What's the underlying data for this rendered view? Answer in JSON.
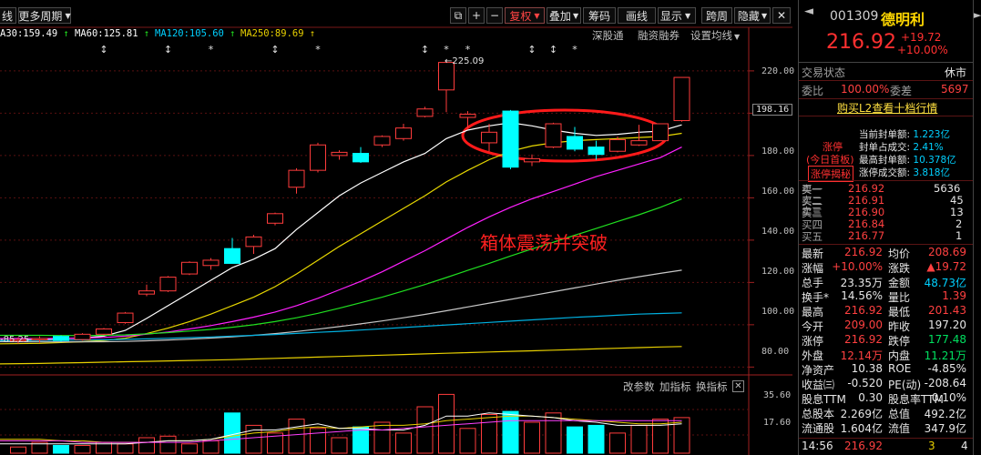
{
  "toolbar": {
    "left_label": "线",
    "period_label": "更多周期",
    "items": [
      "复权",
      "叠加",
      "筹码",
      "画线",
      "显示",
      "跨周",
      "隐藏"
    ]
  },
  "ma_bar": {
    "items": [
      {
        "label": "A30:159.49",
        "arrow": "up",
        "color": "#ffffff"
      },
      {
        "label": "MA60:125.81",
        "arrow": "up",
        "color": "#ffffff"
      },
      {
        "label": "MA120:105.60",
        "arrow": "up",
        "color": "#00d0ff"
      },
      {
        "label": "MA250:89.69",
        "arrow": "up",
        "color": "#e8d000"
      }
    ],
    "menu": [
      "深股通",
      "融资融券",
      "设置均线"
    ]
  },
  "price_axis": {
    "labels": [
      "220.00",
      "200.00",
      "180.00",
      "160.00",
      "140.00",
      "120.00",
      "100.00",
      "80.00"
    ],
    "current": "198.16",
    "low_label": "85.25",
    "high_label": "225.09"
  },
  "annotation": {
    "text": "箱体震荡并突破",
    "color": "#ff2020"
  },
  "indicator": {
    "menu": [
      "改参数",
      "加指标",
      "换指标"
    ],
    "axis": [
      "35.60",
      "17.60"
    ]
  },
  "chart_data": {
    "type": "candlestick",
    "ylim": [
      78,
      232
    ],
    "candles": [
      {
        "o": 92.5,
        "h": 94.0,
        "l": 91.0,
        "c": 93.0
      },
      {
        "o": 93.0,
        "h": 94.5,
        "l": 91.5,
        "c": 93.5
      },
      {
        "o": 94.5,
        "h": 95.0,
        "l": 92.0,
        "c": 92.5
      },
      {
        "o": 93.0,
        "h": 96.0,
        "l": 92.5,
        "c": 95.5
      },
      {
        "o": 95.5,
        "h": 98.5,
        "l": 95.0,
        "c": 98.0
      },
      {
        "o": 101.0,
        "h": 106.0,
        "l": 100.5,
        "c": 105.5
      },
      {
        "o": 114.5,
        "h": 119.0,
        "l": 113.5,
        "c": 116.0
      },
      {
        "o": 116.0,
        "h": 123.0,
        "l": 115.5,
        "c": 122.5
      },
      {
        "o": 124.0,
        "h": 130.0,
        "l": 123.5,
        "c": 129.5
      },
      {
        "o": 128.0,
        "h": 131.5,
        "l": 126.0,
        "c": 130.5
      },
      {
        "o": 136.0,
        "h": 141.0,
        "l": 132.5,
        "c": 129.0
      },
      {
        "o": 137.0,
        "h": 142.5,
        "l": 133.5,
        "c": 141.5
      },
      {
        "o": 148.0,
        "h": 153.0,
        "l": 147.0,
        "c": 152.5
      },
      {
        "o": 165.0,
        "h": 174.0,
        "l": 162.0,
        "c": 173.0
      },
      {
        "o": 173.0,
        "h": 186.0,
        "l": 172.0,
        "c": 185.0
      },
      {
        "o": 180.0,
        "h": 182.5,
        "l": 178.0,
        "c": 181.5
      },
      {
        "o": 181.0,
        "h": 184.0,
        "l": 176.5,
        "c": 177.0
      },
      {
        "o": 185.0,
        "h": 189.5,
        "l": 184.0,
        "c": 189.0
      },
      {
        "o": 188.0,
        "h": 195.0,
        "l": 187.0,
        "c": 193.0
      },
      {
        "o": 198.5,
        "h": 203.0,
        "l": 198.0,
        "c": 202.0
      },
      {
        "o": 211.0,
        "h": 225.09,
        "l": 200.5,
        "c": 224.0
      },
      {
        "o": 198.0,
        "h": 201.0,
        "l": 193.0,
        "c": 199.5
      },
      {
        "o": 186.0,
        "h": 195.0,
        "l": 182.0,
        "c": 191.0
      },
      {
        "o": 201.0,
        "h": 201.5,
        "l": 173.5,
        "c": 174.5
      },
      {
        "o": 177.0,
        "h": 180.5,
        "l": 175.0,
        "c": 178.5
      },
      {
        "o": 184.0,
        "h": 195.5,
        "l": 183.5,
        "c": 195.0
      },
      {
        "o": 189.0,
        "h": 193.5,
        "l": 182.0,
        "c": 183.0
      },
      {
        "o": 184.0,
        "h": 187.0,
        "l": 178.0,
        "c": 180.5
      },
      {
        "o": 182.0,
        "h": 189.0,
        "l": 181.5,
        "c": 187.5
      },
      {
        "o": 185.0,
        "h": 194.5,
        "l": 184.5,
        "c": 187.0
      },
      {
        "o": 187.0,
        "h": 195.0,
        "l": 187.0,
        "c": 195.0
      },
      {
        "o": 196.5,
        "h": 216.92,
        "l": 196.0,
        "c": 216.92
      }
    ],
    "ma_lines": [
      {
        "color": "#ffffff",
        "values": [
          92.5,
          93.0,
          93.3,
          93.8,
          94.6,
          97.3,
          103.0,
          109.0,
          115.0,
          121.0,
          127.0,
          131.0,
          136.0,
          145.0,
          153.0,
          161.0,
          167.0,
          172.0,
          177.0,
          181.0,
          188.0,
          192.0,
          194.0,
          195.5,
          194.0,
          192.0,
          190.5,
          189.5,
          190.0,
          191.0,
          191.5,
          194.5
        ]
      },
      {
        "color": "#e8d800",
        "values": [
          91.0,
          91.2,
          91.6,
          92.0,
          92.6,
          93.6,
          95.8,
          98.4,
          101.5,
          105.0,
          109.0,
          113.0,
          118.0,
          124.0,
          130.5,
          137.0,
          143.0,
          149.0,
          155.0,
          161.0,
          167.5,
          173.0,
          178.0,
          182.0,
          184.5,
          186.0,
          187.0,
          187.5,
          188.0,
          188.5,
          189.0,
          190.5
        ]
      },
      {
        "color": "#ff20ff",
        "values": [
          93.5,
          93.5,
          93.5,
          93.7,
          94.0,
          94.6,
          95.5,
          96.6,
          98.0,
          99.6,
          101.5,
          103.6,
          106.0,
          109.0,
          112.5,
          116.5,
          120.5,
          125.0,
          130.0,
          135.0,
          140.5,
          146.0,
          151.0,
          155.5,
          159.5,
          163.0,
          166.5,
          170.0,
          173.0,
          176.0,
          179.0,
          184.0
        ]
      },
      {
        "color": "#20e020",
        "values": [
          95.0,
          95.0,
          94.9,
          94.9,
          95.0,
          95.2,
          95.7,
          96.3,
          97.0,
          97.8,
          98.8,
          100.0,
          101.5,
          103.3,
          105.4,
          107.8,
          110.4,
          113.0,
          116.0,
          119.0,
          122.3,
          125.7,
          129.0,
          132.5,
          135.8,
          139.0,
          142.3,
          145.5,
          148.8,
          152.0,
          155.5,
          159.49
        ]
      },
      {
        "color": "#c8c8c8",
        "values": [
          92.0,
          91.9,
          91.9,
          91.9,
          92.0,
          92.1,
          92.4,
          92.8,
          93.2,
          93.7,
          94.3,
          95.0,
          95.8,
          96.8,
          97.9,
          99.1,
          100.4,
          101.8,
          103.3,
          104.9,
          106.6,
          108.4,
          110.2,
          112.0,
          113.8,
          115.6,
          117.4,
          119.2,
          121.0,
          122.7,
          124.3,
          125.81
        ]
      },
      {
        "color": "#00b0e0",
        "values": [
          92.5,
          92.6,
          92.7,
          92.8,
          92.9,
          93.1,
          93.3,
          93.6,
          93.9,
          94.2,
          94.6,
          95.0,
          95.4,
          95.9,
          96.4,
          96.9,
          97.5,
          98.1,
          98.7,
          99.3,
          99.9,
          100.5,
          101.1,
          101.7,
          102.3,
          102.9,
          103.5,
          104.0,
          104.5,
          105.0,
          105.3,
          105.6
        ]
      },
      {
        "color": "#e8d000",
        "values": [
          81.5,
          81.7,
          81.9,
          82.1,
          82.3,
          82.5,
          82.7,
          82.9,
          83.1,
          83.3,
          83.5,
          83.8,
          84.1,
          84.4,
          84.7,
          85.0,
          85.3,
          85.6,
          85.9,
          86.2,
          86.5,
          86.8,
          87.1,
          87.4,
          87.7,
          88.0,
          88.3,
          88.6,
          88.9,
          89.2,
          89.5,
          89.69
        ]
      }
    ],
    "volume": {
      "ylim": [
        0,
        40
      ],
      "values": [
        4,
        7,
        5,
        5,
        7,
        6,
        10,
        11,
        6,
        8,
        26,
        18,
        13,
        22,
        16,
        10,
        17,
        20,
        13,
        30,
        38,
        16,
        25,
        27,
        20,
        26,
        17,
        18,
        13,
        18,
        22,
        23
      ],
      "lines": [
        {
          "color": "#e8d000",
          "values": [
            9,
            9,
            8,
            8,
            7,
            7,
            7,
            8,
            8,
            9,
            11,
            13,
            14,
            16,
            17,
            16,
            17,
            18,
            18,
            19,
            21,
            22,
            23,
            24,
            24,
            23,
            22,
            21,
            20,
            19,
            19,
            20
          ]
        },
        {
          "color": "#ffffff",
          "values": [
            6,
            6,
            6,
            6,
            6,
            6,
            7,
            8,
            8,
            9,
            12,
            15,
            15,
            17,
            19,
            16,
            16,
            15,
            15,
            18,
            24,
            24,
            26,
            25,
            24,
            23,
            21,
            20,
            18,
            18,
            18,
            19
          ]
        },
        {
          "color": "#ff40ff",
          "values": [
            8,
            8,
            8,
            7,
            7,
            7,
            7,
            7,
            7,
            8,
            9,
            10,
            11,
            12,
            13,
            14,
            15,
            15,
            16,
            17,
            18,
            19,
            20,
            21,
            21,
            21,
            21,
            21,
            21,
            21,
            21,
            21
          ]
        }
      ]
    }
  },
  "panel": {
    "code": "001309",
    "name": "德明利",
    "price": "216.92",
    "change": "+19.72",
    "change_pct": "+10.00%",
    "trade_status_label": "交易状态",
    "trade_status": "休市",
    "wb_label": "委比",
    "wb_value": "100.00%",
    "wc_label": "委差",
    "wc_value": "5697",
    "l2_link": "购买L2查看十档行情",
    "limit_title": "涨停",
    "limit_sub": "(今日首板)",
    "limit_btn": "涨停揭秘",
    "limit_stats": [
      {
        "label": "当前封单额:",
        "value": "1.223亿"
      },
      {
        "label": "封单占成交:",
        "value": "2.41%"
      },
      {
        "label": "最高封单额:",
        "value": "10.378亿"
      },
      {
        "label": "涨停成交额:",
        "value": "3.818亿"
      }
    ],
    "sells": [
      {
        "label": "卖一",
        "price": "",
        "vol": ""
      },
      {
        "label": "卖二",
        "price": "",
        "vol": ""
      },
      {
        "label": "卖三",
        "price": "",
        "vol": ""
      }
    ],
    "buys": [
      {
        "label": "买一",
        "price": "216.92",
        "vol": "5636"
      },
      {
        "label": "买二",
        "price": "216.91",
        "vol": "45"
      },
      {
        "label": "买三",
        "price": "216.90",
        "vol": "13"
      },
      {
        "label": "买四",
        "price": "216.84",
        "vol": "2"
      },
      {
        "label": "买五",
        "price": "216.77",
        "vol": "1"
      }
    ],
    "stats": [
      {
        "l1": "最新",
        "v1": "216.92",
        "c1": "red",
        "l2": "均价",
        "v2": "208.69",
        "c2": "red"
      },
      {
        "l1": "涨幅",
        "v1": "+10.00%",
        "c1": "red",
        "l2": "涨跌",
        "v2": "▲19.72",
        "c2": "red"
      },
      {
        "l1": "总手",
        "v1": "23.35万",
        "c1": "white",
        "l2": "金额",
        "v2": "48.73亿",
        "c2": "cyan"
      },
      {
        "l1": "换手*",
        "v1": "14.56%",
        "c1": "white",
        "l2": "量比",
        "v2": "1.39",
        "c2": "red"
      },
      {
        "l1": "最高",
        "v1": "216.92",
        "c1": "red",
        "l2": "最低",
        "v2": "201.43",
        "c2": "red"
      },
      {
        "l1": "今开",
        "v1": "209.00",
        "c1": "red",
        "l2": "昨收",
        "v2": "197.20",
        "c2": "white"
      },
      {
        "l1": "涨停",
        "v1": "216.92",
        "c1": "red",
        "l2": "跌停",
        "v2": "177.48",
        "c2": "green"
      },
      {
        "l1": "外盘",
        "v1": "12.14万",
        "c1": "red",
        "l2": "内盘",
        "v2": "11.21万",
        "c2": "green"
      },
      {
        "l1": "净资产",
        "v1": "10.38",
        "c1": "white",
        "l2": "ROE",
        "v2": "-4.85%",
        "c2": "white"
      },
      {
        "l1": "收益㈢",
        "v1": "-0.520",
        "c1": "white",
        "l2": "PE(动)",
        "v2": "-208.64",
        "c2": "white"
      },
      {
        "l1": "股息TTM",
        "v1": "0.30",
        "c1": "white",
        "l2": "股息率TTM",
        "v2": "0.10%",
        "c2": "white"
      },
      {
        "l1": "总股本",
        "v1": "2.269亿",
        "c1": "white",
        "l2": "总值",
        "v2": "492.2亿",
        "c2": "white"
      },
      {
        "l1": "流通股",
        "v1": "1.604亿",
        "c1": "white",
        "l2": "流值",
        "v2": "347.9亿",
        "c2": "white"
      }
    ],
    "tick": {
      "time": "14:56",
      "price": "216.92",
      "vol": "3",
      "count": "4"
    }
  }
}
